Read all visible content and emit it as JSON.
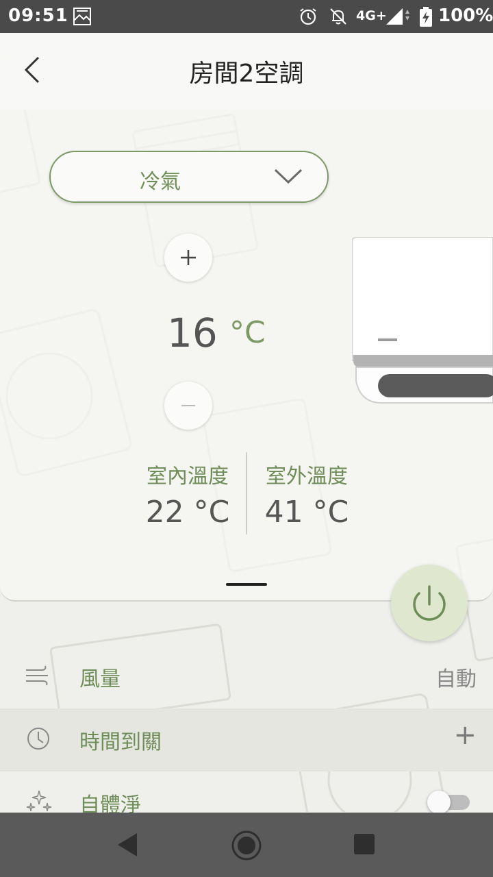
{
  "status_bar": {
    "time": "09:51",
    "network": "4G+",
    "battery": "100%",
    "icons": [
      "notification-image-icon",
      "alarm-icon",
      "bell-off-icon",
      "signal-icon",
      "battery-charging-icon"
    ]
  },
  "header": {
    "title": "房間2空調",
    "back_icon": "chevron-left-icon"
  },
  "mode": {
    "selected": "冷氣"
  },
  "temperature": {
    "value": "16",
    "unit": "°C"
  },
  "environment": {
    "indoor_label": "室內溫度",
    "indoor_value": "22 °C",
    "outdoor_label": "室外溫度",
    "outdoor_value": "41 °C"
  },
  "settings": [
    {
      "label": "風量",
      "value": "自動",
      "icon": "wind-icon"
    },
    {
      "label": "時間到關",
      "value": "+",
      "icon": "clock-icon"
    },
    {
      "label": "自體淨",
      "icon": "sparkle-icon",
      "toggle_on": false
    }
  ],
  "colors": {
    "accent": "#6f8d58",
    "power_bg": "#dfe8cf",
    "status_bar": "#4a4a4a",
    "nav_bar": "#5a5a5a"
  }
}
